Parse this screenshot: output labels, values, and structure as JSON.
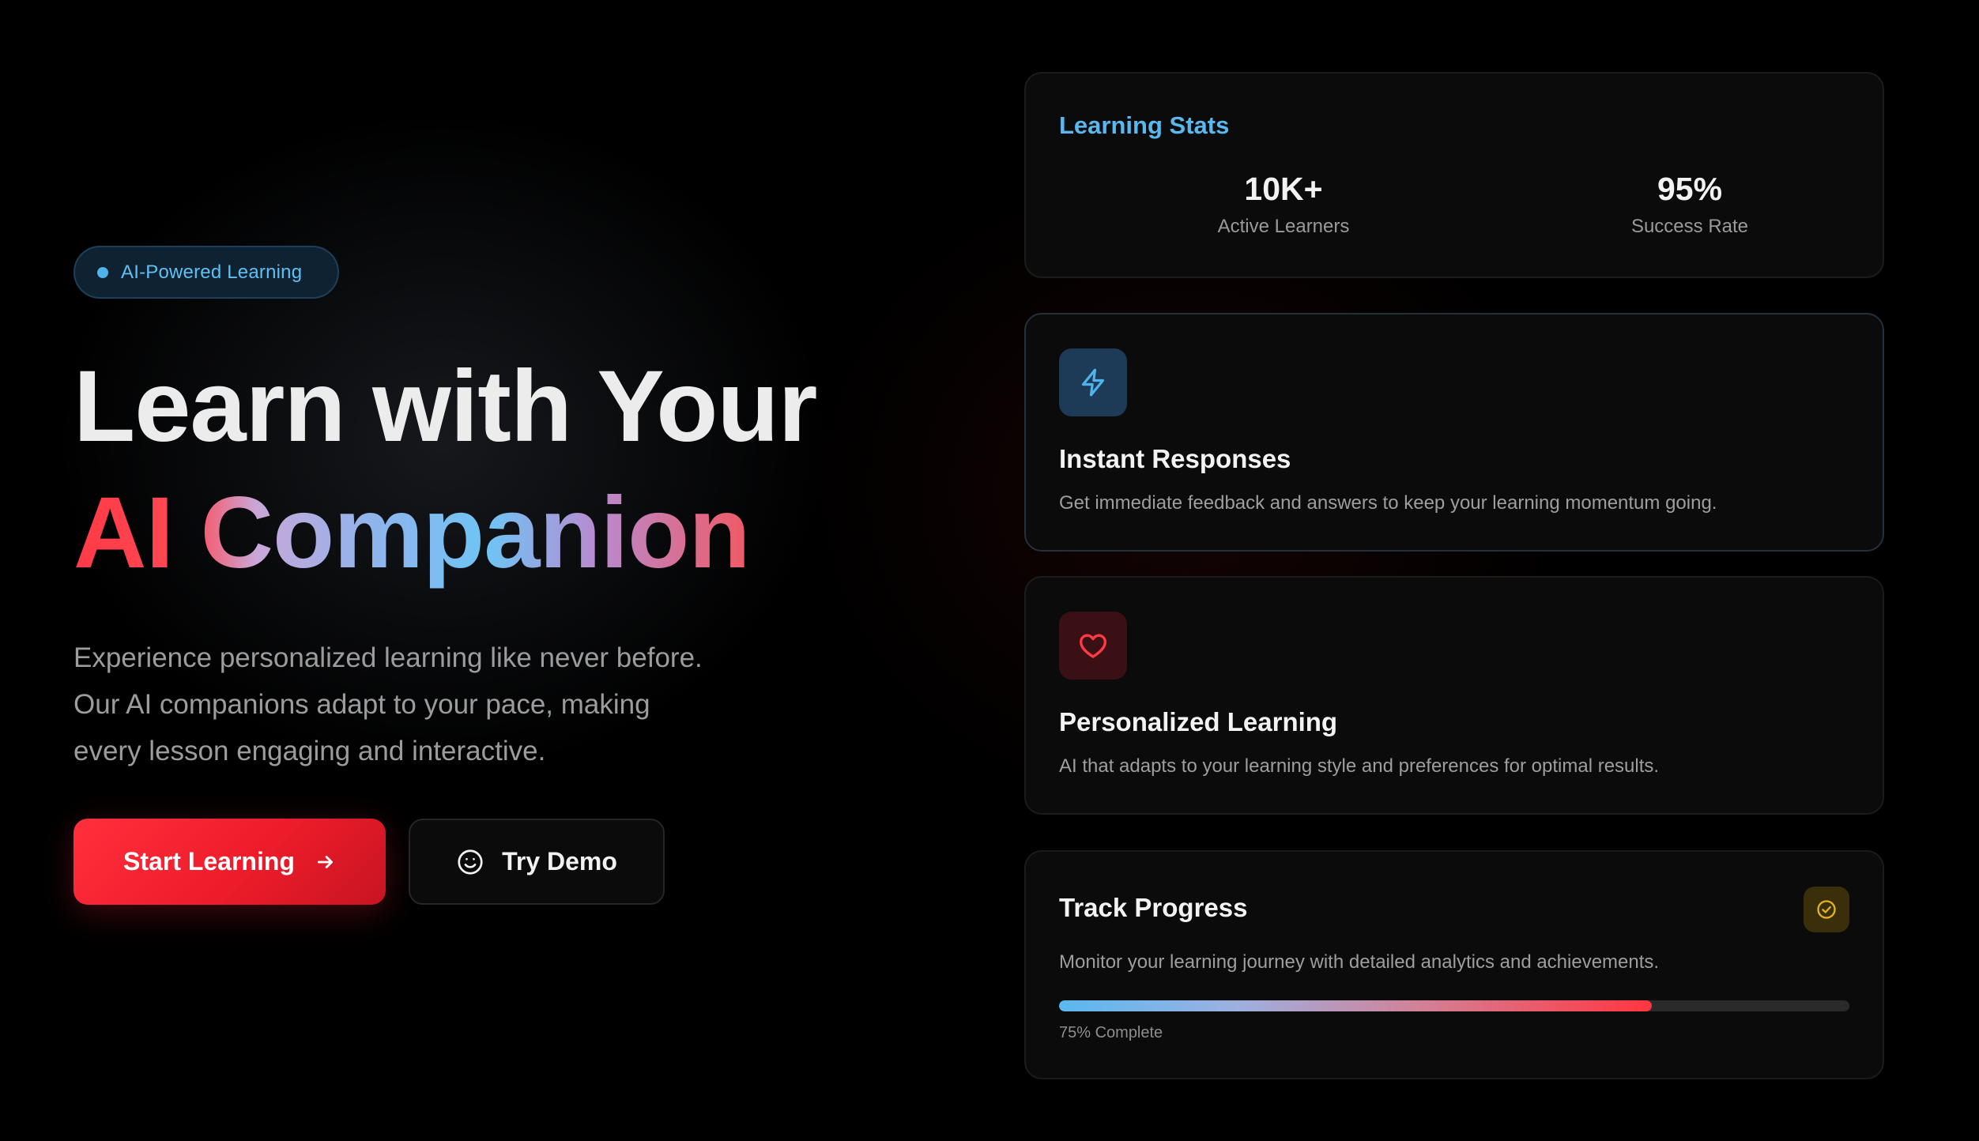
{
  "hero": {
    "badge_label": "AI-Powered Learning",
    "headline_line1": "Learn with Your",
    "headline_line2": "AI Companion",
    "lead_text": "Experience personalized learning like never before. Our AI companions adapt to your pace, making every lesson engaging and interactive.",
    "primary_button_label": "Start Learning",
    "primary_button_icon": "arrow-right-icon",
    "secondary_button_label": "Try Demo",
    "secondary_button_icon": "smile-icon"
  },
  "stats": {
    "title": "Learning Stats",
    "items": [
      {
        "value": "10K+",
        "label": "Active Learners"
      },
      {
        "value": "95%",
        "label": "Success Rate"
      }
    ]
  },
  "features": [
    {
      "icon": "lightning-icon",
      "title": "Instant Responses",
      "description": "Get immediate feedback and answers to keep your learning momentum going."
    },
    {
      "icon": "heart-icon",
      "title": "Personalized Learning",
      "description": "AI that adapts to your learning style and preferences for optimal results."
    }
  ],
  "progress": {
    "title": "Track Progress",
    "icon": "check-circle-icon",
    "description": "Monitor your learning journey with detailed analytics and achievements.",
    "percent": 75,
    "caption": "75% Complete"
  },
  "colors": {
    "accent_blue": "#58b8ef",
    "accent_red": "#ff2f3c",
    "background": "#000000",
    "card": "#0c0c0d"
  }
}
